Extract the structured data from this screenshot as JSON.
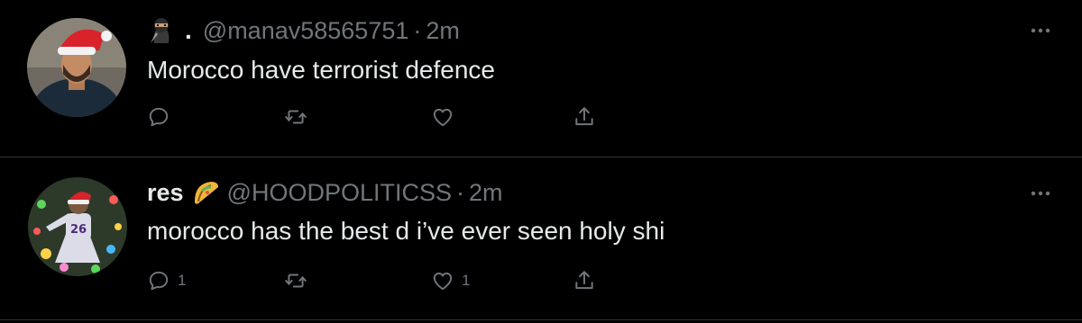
{
  "colors": {
    "background": "#000000",
    "text_primary": "#e7e9ea",
    "text_secondary": "#71767b",
    "divider": "#2f3336"
  },
  "tweets": [
    {
      "display_name": ".",
      "name_icon": "ninja-emoji-icon",
      "handle": "@manav58565751",
      "separator": "·",
      "time": "2m",
      "text": "Morocco have terrorist defence",
      "avatar_icon": "santa-hat-avatar",
      "actions": {
        "reply_count": "",
        "retweet_count": "",
        "like_count": ""
      }
    },
    {
      "display_name": "res",
      "name_icon": "taco-emoji-icon",
      "handle": "@HOODPOLITICSS",
      "separator": "·",
      "time": "2m",
      "text": "morocco has the best d i’ve ever seen holy shi",
      "avatar_icon": "football-player-avatar",
      "actions": {
        "reply_count": "1",
        "retweet_count": "",
        "like_count": "1"
      }
    }
  ]
}
